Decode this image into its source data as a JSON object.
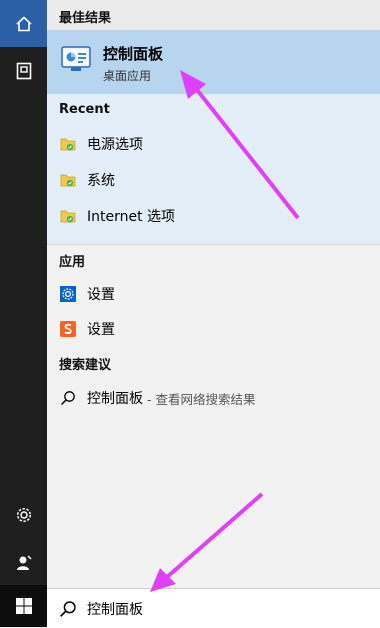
{
  "rail": {
    "icons": [
      "home-icon",
      "recent-docs-icon",
      "gear-icon",
      "person-icon",
      "windows-logo-icon"
    ]
  },
  "best_match": {
    "header": "最佳结果",
    "title": "控制面板",
    "subtitle": "桌面应用"
  },
  "recent": {
    "header": "Recent",
    "items": [
      {
        "label": "电源选项"
      },
      {
        "label": "系统"
      },
      {
        "label": "Internet 选项"
      }
    ]
  },
  "apps": {
    "header": "应用",
    "items": [
      {
        "label": "设置"
      },
      {
        "label": "设置"
      }
    ]
  },
  "suggestions": {
    "header": "搜索建议",
    "item": {
      "label": "控制面板",
      "hint": "- 查看网络搜索结果"
    }
  },
  "search": {
    "value": "控制面板"
  },
  "colors": {
    "accent": "#2b5fa6",
    "best_highlight": "#b8d5f0",
    "annotation_arrow": "#e040fb"
  }
}
